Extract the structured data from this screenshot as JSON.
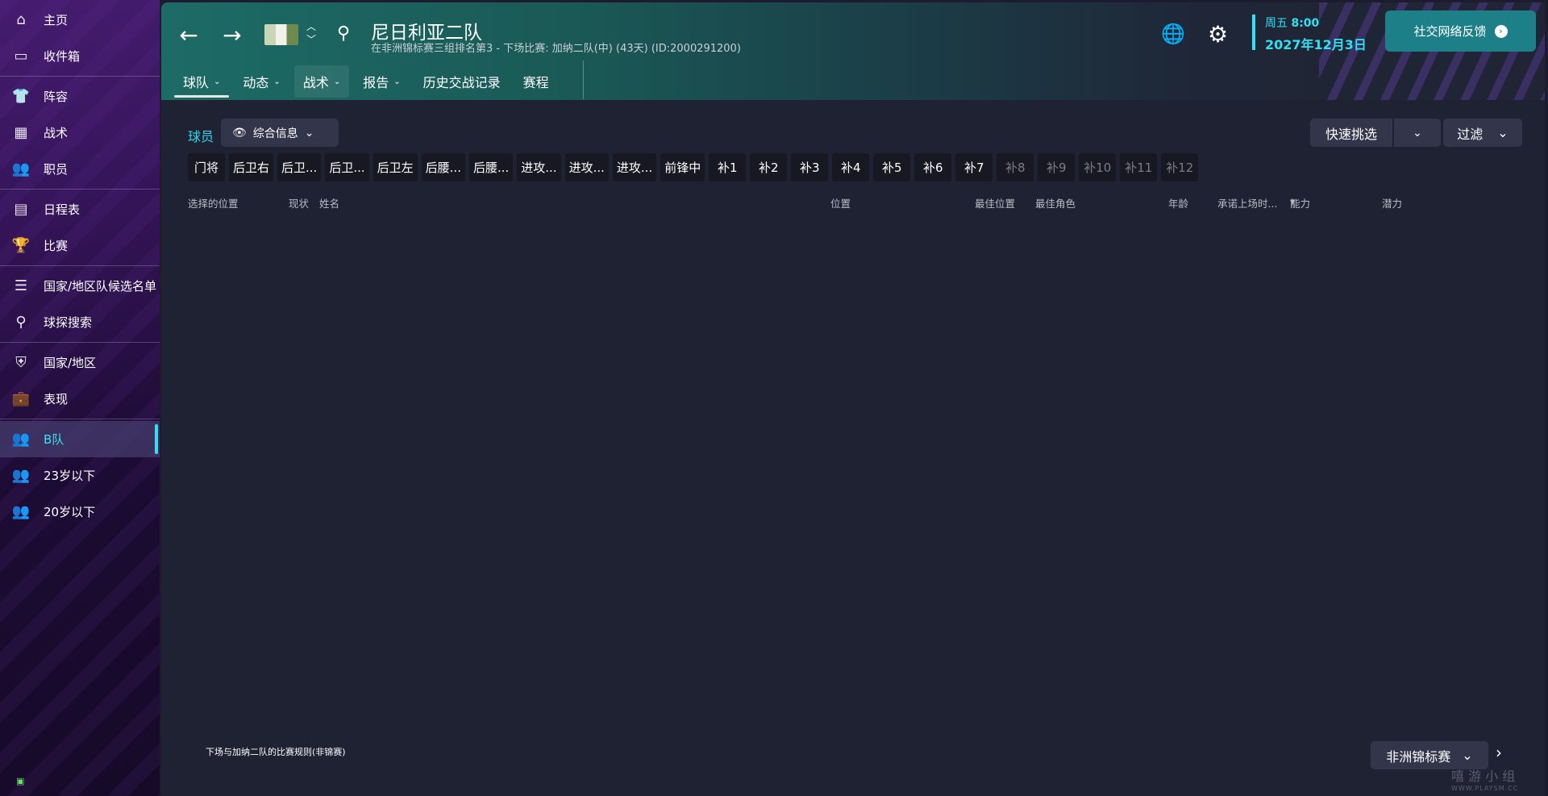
{
  "sidebar": {
    "groups": [
      [
        {
          "label": "主页",
          "icon": "home-icon"
        },
        {
          "label": "收件箱",
          "icon": "inbox-icon"
        }
      ],
      [
        {
          "label": "阵容",
          "icon": "shirt-icon"
        },
        {
          "label": "战术",
          "icon": "tactics-icon"
        },
        {
          "label": "职员",
          "icon": "staff-icon"
        }
      ],
      [
        {
          "label": "日程表",
          "icon": "calendar-icon"
        },
        {
          "label": "比赛",
          "icon": "trophy-icon"
        }
      ],
      [
        {
          "label": "国家/地区队候选名单",
          "icon": "list-icon"
        },
        {
          "label": "球探搜索",
          "icon": "search-icon"
        }
      ],
      [
        {
          "label": "国家/地区",
          "icon": "shield-icon"
        },
        {
          "label": "表现",
          "icon": "briefcase-icon"
        }
      ],
      [
        {
          "label": "B队",
          "icon": "team-b-icon",
          "active": true
        },
        {
          "label": "23岁以下",
          "icon": "team-u23-icon"
        },
        {
          "label": "20岁以下",
          "icon": "team-u20-icon"
        }
      ]
    ]
  },
  "header": {
    "title": "尼日利亚二队",
    "subtitle": "在非洲锦标赛三组排名第3 - 下场比赛: 加纳二队(中) (43天) (ID:2000291200)",
    "date_day": "周五",
    "date_time": "8:00",
    "date_full": "2027年12月3日",
    "social_label": "社交网络反馈",
    "accent": "#2fe1f3",
    "tabs": [
      {
        "label": "球队",
        "chevron": true,
        "active": true
      },
      {
        "label": "动态",
        "chevron": true
      },
      {
        "label": "战术",
        "chevron": true,
        "highlight": true
      },
      {
        "label": "报告",
        "chevron": true
      },
      {
        "label": "历史交战记录",
        "chevron": false
      },
      {
        "label": "赛程",
        "chevron": false
      }
    ]
  },
  "main": {
    "players_label": "球员",
    "view_label": "综合信息",
    "quick_pick_label": "快速挑选",
    "filter_label": "过滤",
    "positions": [
      {
        "label": "门将"
      },
      {
        "label": "后卫右"
      },
      {
        "label": "后卫..."
      },
      {
        "label": "后卫..."
      },
      {
        "label": "后卫左"
      },
      {
        "label": "后腰..."
      },
      {
        "label": "后腰..."
      },
      {
        "label": "进攻..."
      },
      {
        "label": "进攻..."
      },
      {
        "label": "进攻..."
      },
      {
        "label": "前锋中"
      },
      {
        "label": "补1"
      },
      {
        "label": "补2"
      },
      {
        "label": "补3"
      },
      {
        "label": "补4"
      },
      {
        "label": "补5"
      },
      {
        "label": "补6"
      },
      {
        "label": "补7"
      },
      {
        "label": "补8",
        "dim": true
      },
      {
        "label": "补9",
        "dim": true
      },
      {
        "label": "补10",
        "dim": true
      },
      {
        "label": "补11",
        "dim": true
      },
      {
        "label": "补12",
        "dim": true
      }
    ],
    "columns": {
      "selected_position": "选择的位置",
      "status": "现状",
      "name": "姓名",
      "position": "位置",
      "best_position": "最佳位置",
      "best_role": "最佳角色",
      "age": "年龄",
      "promised_time": "承诺上场时...",
      "ability": "能力",
      "potential": "潜力"
    },
    "footer_rule": "下场与加纳二队的比赛规则(非锦赛)",
    "competition": "非洲锦标赛"
  },
  "watermark": {
    "text": "嘻 游 小 组",
    "url": "WWW.PLAYSM.CC"
  }
}
